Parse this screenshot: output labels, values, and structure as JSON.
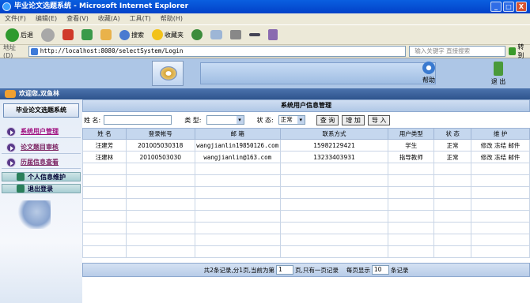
{
  "window": {
    "title": "毕业论文选题系统 - Microsoft Internet Explorer",
    "min": "_",
    "max": "□",
    "close": "X"
  },
  "menu": [
    "文件(F)",
    "编辑(E)",
    "查看(V)",
    "收藏(A)",
    "工具(T)",
    "帮助(H)"
  ],
  "toolbar": {
    "back": "后退",
    "search": "搜索",
    "favorites": "收藏夹"
  },
  "address": {
    "label": "地址(D)",
    "url": "http://localhost:8080/selectSystem/Login",
    "search_placeholder": "输入关键字 直接搜索",
    "go": "转到"
  },
  "banner": {
    "help": "帮助",
    "exit": "退 出"
  },
  "welcome": "欢迎您,双鱼林",
  "sidebar": {
    "title": "毕业论文选题系统",
    "items": [
      "系统用户管理",
      "论文题目审核",
      "历届信息查看"
    ],
    "sub": [
      "个人信息维护",
      "退出登录"
    ]
  },
  "content": {
    "title": "系统用户信息管理",
    "filter": {
      "name_label": "姓 名:",
      "type_label": "类 型:",
      "status_label": "状 态:",
      "status_value": "正常",
      "query": "查 询",
      "add": "增 加",
      "import": "导 入"
    },
    "columns": [
      "姓 名",
      "登录帐号",
      "邮 箱",
      "联系方式",
      "用户类型",
      "状 态",
      "维 护"
    ],
    "rows": [
      {
        "name": "汪建芳",
        "account": "201005030318",
        "email": "wangjianlin19850126.com",
        "phone": "15982129421",
        "type": "学生",
        "status": "正常",
        "ops": "修改 冻结 邮件"
      },
      {
        "name": "汪建林",
        "account": "20100503030",
        "email": "wangjianlin@163.com",
        "phone": "13233403931",
        "type": "指导教师",
        "status": "正常",
        "ops": "修改 冻结 邮件"
      }
    ],
    "footer": {
      "text1": "共2条记录,分1页,当前为第",
      "page": "1",
      "text2": "页,只有一页记录",
      "text3": "每页显示",
      "per": "10",
      "text4": "条记录"
    }
  }
}
